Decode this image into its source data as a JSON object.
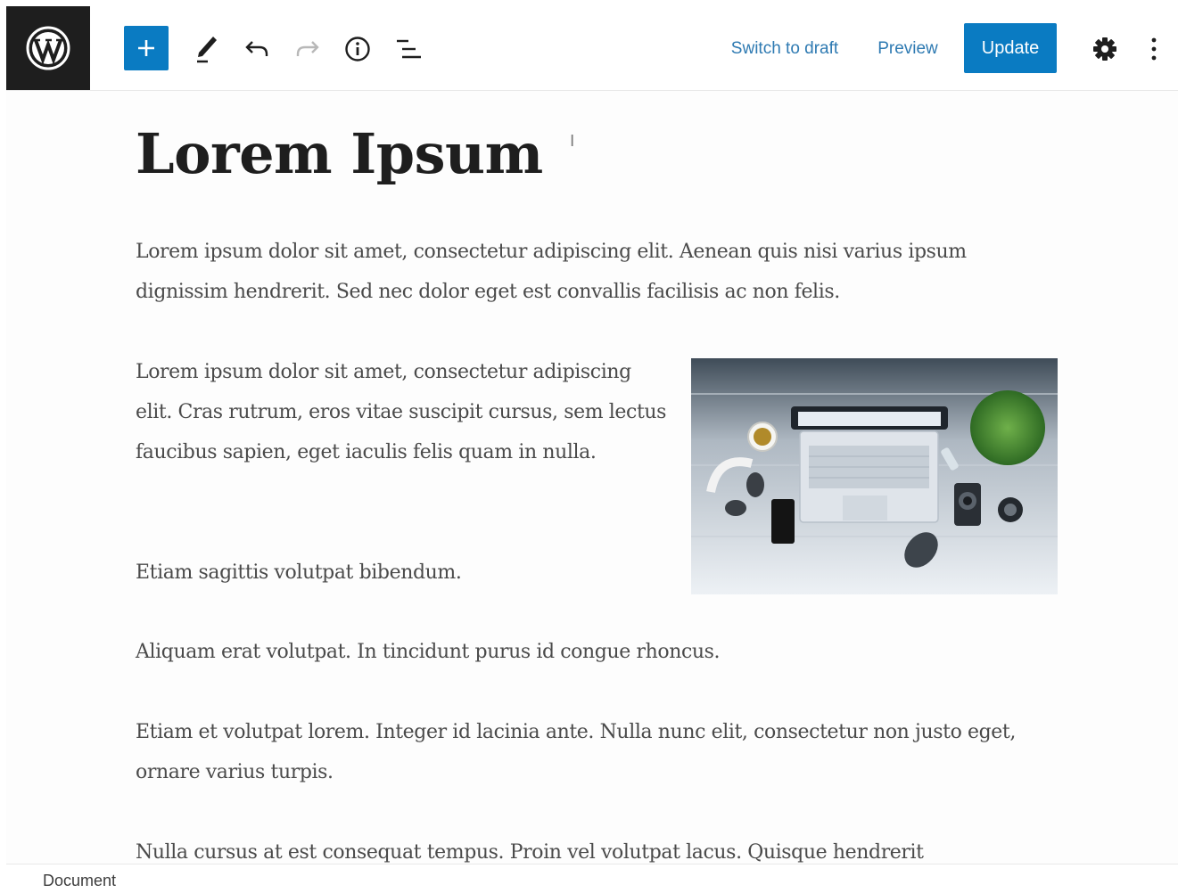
{
  "toolbar": {
    "add_label": "+",
    "switch_to_draft": "Switch to draft",
    "preview": "Preview",
    "update": "Update"
  },
  "icons": {
    "logo": "wordpress-logo",
    "add": "plus-icon",
    "tools": "pencil-icon",
    "undo": "undo-icon",
    "redo": "redo-icon",
    "details": "info-icon",
    "outline": "list-view-icon",
    "settings": "gear-icon",
    "options": "more-vertical-icon"
  },
  "colors": {
    "accent": "#0a7bc2",
    "link": "#2e7ab2",
    "logo_bg": "#1e1e1e",
    "text": "#4a4a4a"
  },
  "post": {
    "title": "Lorem Ipsum",
    "paragraphs": [
      "Lorem ipsum dolor sit amet, consectetur adipiscing elit. Aenean quis nisi varius ipsum dignissim hendrerit. Sed nec dolor eget est convallis facilisis ac non felis.",
      "Lorem ipsum dolor sit amet, consectetur adipiscing elit. Cras rutrum, eros vitae suscipit cursus, sem lectus faucibus sapien, eget iaculis felis quam in nulla.",
      "Etiam sagittis volutpat bibendum.",
      "Aliquam erat volutpat. In tincidunt purus id congue rhoncus.",
      "Etiam et volutpat lorem. Integer id lacinia ante. Nulla nunc elit, consectetur non justo eget, ornare varius turpis.",
      "Nulla cursus at est consequat tempus. Proin vel volutpat lacus. Quisque hendrerit"
    ]
  },
  "footer": {
    "breadcrumb": "Document"
  }
}
